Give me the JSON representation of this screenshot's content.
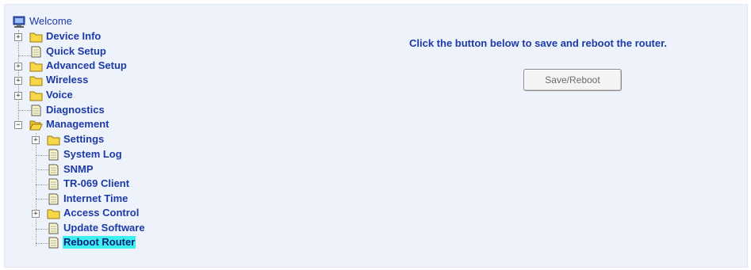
{
  "tree": {
    "root_label": "Welcome",
    "items": [
      {
        "label": "Device Info"
      },
      {
        "label": "Quick Setup"
      },
      {
        "label": "Advanced Setup"
      },
      {
        "label": "Wireless"
      },
      {
        "label": "Voice"
      },
      {
        "label": "Diagnostics"
      },
      {
        "label": "Management"
      },
      {
        "label": "Settings"
      },
      {
        "label": "System Log"
      },
      {
        "label": "SNMP"
      },
      {
        "label": "TR-069 Client"
      },
      {
        "label": "Internet Time"
      },
      {
        "label": "Access Control"
      },
      {
        "label": "Update Software"
      },
      {
        "label": "Reboot Router"
      }
    ],
    "selected_item": "Reboot Router"
  },
  "main": {
    "instruction": "Click the button below to save and reboot the router.",
    "button_label": "Save/Reboot"
  },
  "colors": {
    "link_text": "#1d3aa8",
    "selection_highlight": "#3ff0f0",
    "panel_background": "#eef2fb",
    "folder_yellow": "#f6d84a"
  }
}
